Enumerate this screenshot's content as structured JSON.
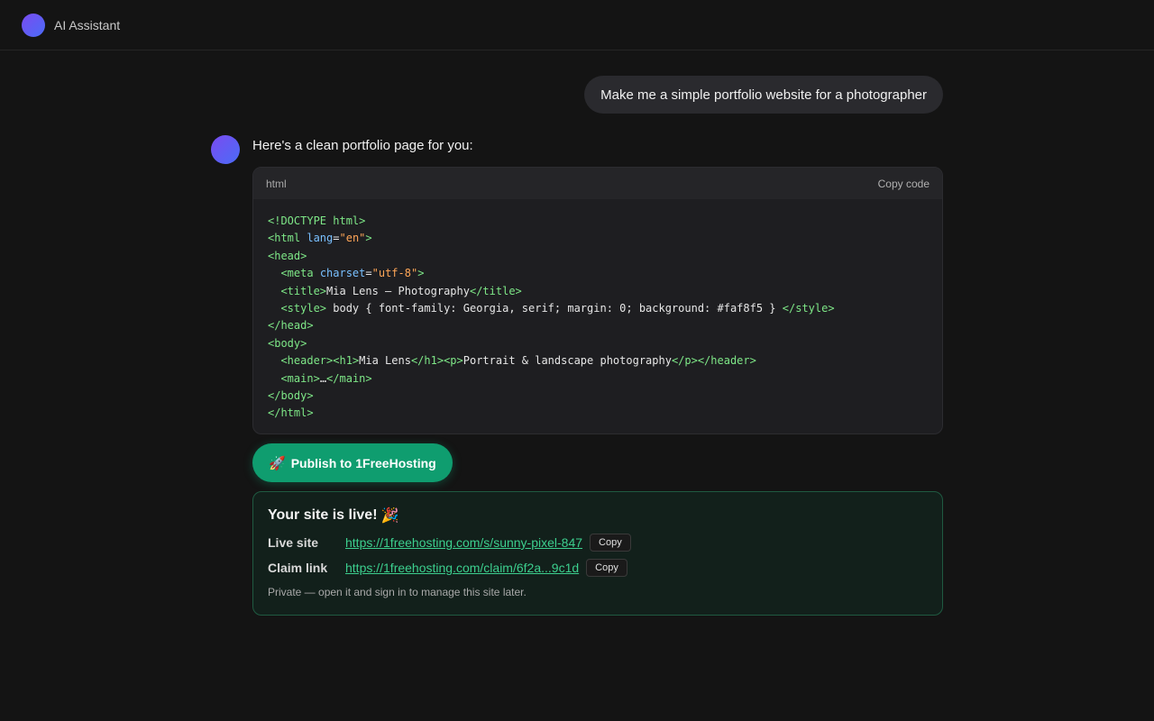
{
  "app": {
    "title": "AI Assistant"
  },
  "chat": {
    "user_message": "Make me a simple portfolio website for a photographer",
    "assistant_intro": "Here's a clean portfolio page for you:",
    "code": {
      "language": "html",
      "copy_label": "Copy code",
      "lines": [
        [
          [
            "tag",
            "<!DOCTYPE html>"
          ]
        ],
        [
          [
            "tag",
            "<html "
          ],
          [
            "attr",
            "lang"
          ],
          [
            "txt",
            "="
          ],
          [
            "str",
            "\"en\""
          ],
          [
            "tag",
            ">"
          ]
        ],
        [
          [
            "tag",
            "<head>"
          ]
        ],
        [
          [
            "txt",
            "  "
          ],
          [
            "tag",
            "<meta "
          ],
          [
            "attr",
            "charset"
          ],
          [
            "txt",
            "="
          ],
          [
            "str",
            "\"utf-8\""
          ],
          [
            "tag",
            ">"
          ]
        ],
        [
          [
            "txt",
            "  "
          ],
          [
            "tag",
            "<title>"
          ],
          [
            "txt",
            "Mia Lens — Photography"
          ],
          [
            "tag",
            "</title>"
          ]
        ],
        [
          [
            "txt",
            "  "
          ],
          [
            "tag",
            "<style>"
          ],
          [
            "txt",
            " body { font-family: Georgia, serif; margin: 0; background: #faf8f5 } "
          ],
          [
            "tag",
            "</style>"
          ]
        ],
        [
          [
            "tag",
            "</head>"
          ]
        ],
        [
          [
            "tag",
            "<body>"
          ]
        ],
        [
          [
            "txt",
            "  "
          ],
          [
            "tag",
            "<header><h1>"
          ],
          [
            "txt",
            "Mia Lens"
          ],
          [
            "tag",
            "</h1><p>"
          ],
          [
            "txt",
            "Portrait & landscape photography"
          ],
          [
            "tag",
            "</p></header>"
          ]
        ],
        [
          [
            "txt",
            "  "
          ],
          [
            "tag",
            "<main>"
          ],
          [
            "txt",
            "…"
          ],
          [
            "tag",
            "</main>"
          ]
        ],
        [
          [
            "tag",
            "</body>"
          ]
        ],
        [
          [
            "tag",
            "</html>"
          ]
        ]
      ]
    },
    "publish_button": {
      "icon": "rocket-icon",
      "label": "Publish to 1FreeHosting"
    },
    "result": {
      "title": "Your site is live!",
      "title_icon": "party-icon",
      "live_label": "Live site",
      "live_url": "https://1freehosting.com/s/sunny-pixel-847",
      "claim_label": "Claim link",
      "claim_url": "https://1freehosting.com/claim/6f2a...9c1d",
      "copy_label": "Copy",
      "note": "Private — open it and sign in to manage this site later."
    }
  },
  "colors": {
    "background": "#141414",
    "accent_green": "#0f9d6f",
    "link_green": "#3ccf8e",
    "avatar_gradient_start": "#7a4bf0",
    "avatar_gradient_end": "#4a6cf7"
  }
}
